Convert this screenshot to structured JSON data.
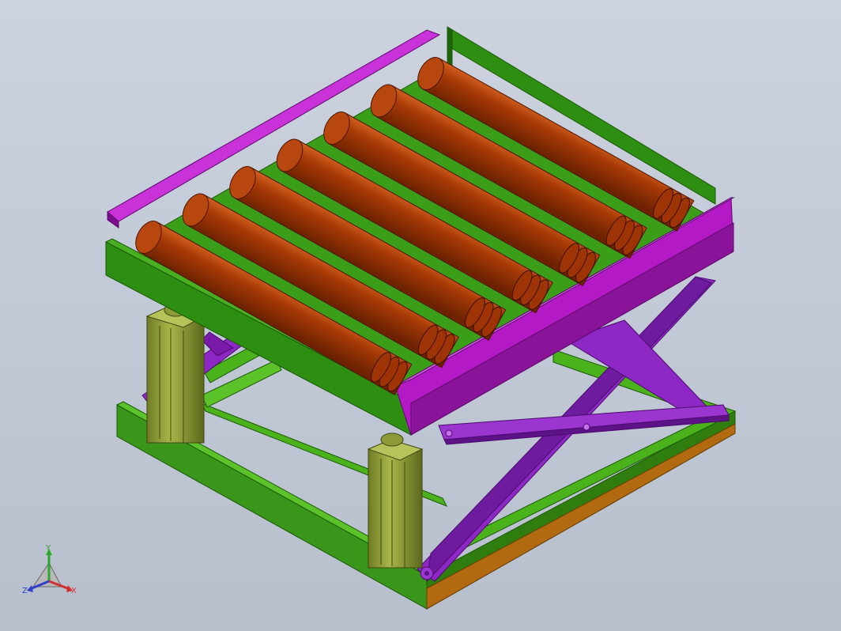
{
  "viewport": {
    "background_top": "#ccd3df",
    "background_bottom": "#b7bfcd",
    "model_colors": {
      "roller": "#a83a06",
      "roller_highlight": "#cf5a1c",
      "roller_frame": "#b319c4",
      "roller_frame_dark": "#7c0d8c",
      "upper_frame": "#2d8e12",
      "upper_frame_dark": "#1d6409",
      "base_frame": "#4ab21a",
      "base_frame_dark": "#2f7d0e",
      "scissor_arm": "#8e28c4",
      "scissor_arm_dark": "#5e1288",
      "cylinder": "#8c9b36",
      "cylinder_dark": "#5f6c1f",
      "base_plate": "#b26a10"
    },
    "roller_count": 7
  },
  "triad": {
    "y_label": "Y",
    "x_label": "X",
    "z_label": "Z",
    "x_color": "#d03030",
    "y_color": "#2fa52f",
    "z_color": "#3040c8"
  }
}
